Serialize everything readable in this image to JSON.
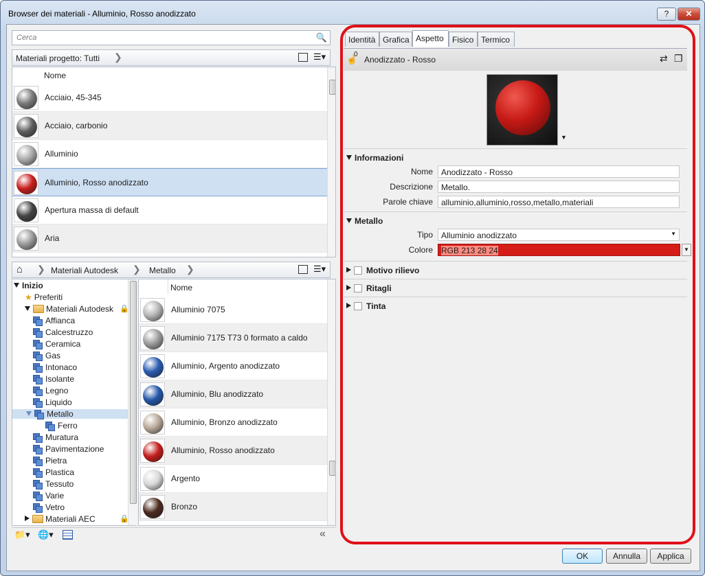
{
  "window": {
    "title": "Browser dei materiali - Alluminio, Rosso anodizzato",
    "help": "?",
    "close": "✕"
  },
  "search": {
    "placeholder": "Cerca"
  },
  "project": {
    "filter": "Materiali progetto: Tutti",
    "col_header": "Nome",
    "items": [
      {
        "name": "Acciaio, 45-345",
        "color": "#7a7a7a"
      },
      {
        "name": "Acciaio, carbonio",
        "color": "#5e5e5e"
      },
      {
        "name": "Alluminio",
        "color": "#a8a8a8"
      },
      {
        "name": "Alluminio, Rosso anodizzato",
        "color": "#c8201e"
      },
      {
        "name": "Apertura massa di default",
        "color": "#444444"
      },
      {
        "name": "Aria",
        "color": "#9a9a9a"
      }
    ],
    "selected_index": 3
  },
  "library": {
    "crumbs": [
      "Materiali Autodesk",
      "Metallo"
    ],
    "col_header": "Nome",
    "tree": [
      {
        "label": "Inizio",
        "level": 0,
        "kind": "root"
      },
      {
        "label": "Preferiti",
        "level": 1,
        "kind": "star"
      },
      {
        "label": "Materiali Autodesk",
        "level": 1,
        "kind": "folder",
        "lock": true
      },
      {
        "label": "Affianca",
        "level": 2,
        "kind": "cat"
      },
      {
        "label": "Calcestruzzo",
        "level": 2,
        "kind": "cat"
      },
      {
        "label": "Ceramica",
        "level": 2,
        "kind": "cat"
      },
      {
        "label": "Gas",
        "level": 2,
        "kind": "cat"
      },
      {
        "label": "Intonaco",
        "level": 2,
        "kind": "cat"
      },
      {
        "label": "Isolante",
        "level": 2,
        "kind": "cat"
      },
      {
        "label": "Legno",
        "level": 2,
        "kind": "cat"
      },
      {
        "label": "Liquido",
        "level": 2,
        "kind": "cat"
      },
      {
        "label": "Metallo",
        "level": 2,
        "kind": "cat",
        "selected": true
      },
      {
        "label": "Ferro",
        "level": 3,
        "kind": "cat"
      },
      {
        "label": "Muratura",
        "level": 2,
        "kind": "cat"
      },
      {
        "label": "Pavimentazione",
        "level": 2,
        "kind": "cat"
      },
      {
        "label": "Pietra",
        "level": 2,
        "kind": "cat"
      },
      {
        "label": "Plastica",
        "level": 2,
        "kind": "cat"
      },
      {
        "label": "Tessuto",
        "level": 2,
        "kind": "cat"
      },
      {
        "label": "Varie",
        "level": 2,
        "kind": "cat"
      },
      {
        "label": "Vetro",
        "level": 2,
        "kind": "cat"
      },
      {
        "label": "Materiali AEC",
        "level": 1,
        "kind": "folder",
        "lock": true
      }
    ],
    "items": [
      {
        "name": "Alluminio 7075",
        "color": "#b5b5b5"
      },
      {
        "name": "Alluminio 7175 T73 0 formato a caldo",
        "color": "#9c9c9c"
      },
      {
        "name": "Alluminio, Argento anodizzato",
        "color": "#2a5bb0"
      },
      {
        "name": "Alluminio, Blu anodizzato",
        "color": "#2456a8"
      },
      {
        "name": "Alluminio, Bronzo anodizzato",
        "color": "#b8a898"
      },
      {
        "name": "Alluminio, Rosso anodizzato",
        "color": "#c41e1c"
      },
      {
        "name": "Argento",
        "color": "#d8d8d8"
      },
      {
        "name": "Bronzo",
        "color": "#4a2a1e"
      }
    ]
  },
  "tabs": [
    "Identità",
    "Grafica",
    "Aspetto",
    "Fisico",
    "Termico"
  ],
  "active_tab": "Aspetto",
  "asset": {
    "name": "Anodizzato - Rosso",
    "count": "0"
  },
  "info": {
    "heading": "Informazioni",
    "fields": [
      {
        "label": "Nome",
        "value": "Anodizzato - Rosso"
      },
      {
        "label": "Descrizione",
        "value": "Metallo."
      },
      {
        "label": "Parole chiave",
        "value": "alluminio,alluminio,rosso,metallo,materiali"
      }
    ]
  },
  "metal": {
    "heading": "Metallo",
    "type_label": "Tipo",
    "type_value": "Alluminio anodizzato",
    "color_label": "Colore",
    "color_value": "RGB 213 28 24",
    "color_hex": "#d51c18"
  },
  "collapsed": [
    "Motivo rilievo",
    "Ritagli",
    "Tinta"
  ],
  "buttons": {
    "ok": "OK",
    "cancel": "Annulla",
    "apply": "Applica"
  }
}
